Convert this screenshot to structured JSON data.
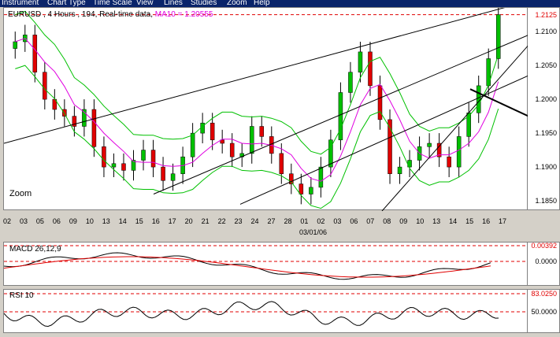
{
  "menu": [
    "Instrument",
    "Chart Type",
    "Time Scale",
    "View",
    "Lines",
    "Studies",
    "Zoom",
    "Help"
  ],
  "header": {
    "title": "EURUSD , 4 Hours , 194, Real-time data",
    "ma": "MA10 = 1.20555"
  },
  "zoom_label": "Zoom",
  "date_ticks": [
    "02",
    "03",
    "05",
    "06",
    "09",
    "10",
    "13",
    "14",
    "15",
    "16",
    "17",
    "20",
    "21",
    "22",
    "23",
    "24",
    "27",
    "28",
    "01",
    "02",
    "03",
    "06",
    "07",
    "08",
    "09",
    "10",
    "13",
    "14",
    "15",
    "16",
    "17"
  ],
  "date_center": "03/01/06",
  "price_axis": {
    "ticks": [
      "1.2125",
      "1.2100",
      "1.2050",
      "1.2000",
      "1.1950",
      "1.1900",
      "1.1850"
    ],
    "current": "1.2125"
  },
  "macd": {
    "label": "MACD 26,12,9",
    "ticks": [
      "0.00392",
      "0.0000"
    ]
  },
  "rsi": {
    "label": "RSI 10",
    "ticks": [
      "83.0250",
      "50.0000"
    ]
  },
  "colors": {
    "menubar": "#0a246a",
    "up_candle": "#00c000",
    "down_candle": "#e00000",
    "bollinger": "#00c000",
    "ma": "#e000e0",
    "ref_line": "#e00000"
  },
  "chart_data": [
    {
      "type": "candlestick",
      "title": "EURUSD , 4 Hours , 194, Real-time data",
      "xlabel": "03/01/06",
      "ylim": [
        1.1835,
        1.2135
      ],
      "price_ticks": [
        1.2125,
        1.21,
        1.205,
        1.2,
        1.195,
        1.19,
        1.185
      ],
      "dates": [
        "02",
        "03",
        "05",
        "06",
        "09",
        "10",
        "13",
        "14",
        "15",
        "16",
        "17",
        "20",
        "21",
        "22",
        "23",
        "24",
        "27",
        "28",
        "01",
        "02",
        "03",
        "06",
        "07",
        "08",
        "09",
        "10",
        "13",
        "14",
        "15",
        "16",
        "17"
      ],
      "close": [
        1.2085,
        1.2095,
        1.204,
        1.2,
        1.1985,
        1.1975,
        1.196,
        1.1985,
        1.193,
        1.19,
        1.1905,
        1.1895,
        1.191,
        1.1925,
        1.19,
        1.188,
        1.189,
        1.1915,
        1.195,
        1.1965,
        1.194,
        1.1935,
        1.1915,
        1.192,
        1.196,
        1.1945,
        1.192,
        1.189,
        1.1875,
        1.186,
        1.187,
        1.19,
        1.194,
        1.201,
        1.204,
        1.207,
        1.202,
        1.197,
        1.189,
        1.19,
        1.191,
        1.193,
        1.1935,
        1.1915,
        1.19,
        1.1945,
        1.198,
        1.202,
        1.206,
        1.2125
      ],
      "ma_label": "MA10 = 1.20555",
      "current": 1.2125
    },
    {
      "type": "line",
      "title": "MACD 26,12,9",
      "ref_levels": [
        0.00392,
        0.0
      ]
    },
    {
      "type": "line",
      "title": "RSI 10",
      "ref_levels": [
        83.025,
        50.0
      ]
    }
  ]
}
